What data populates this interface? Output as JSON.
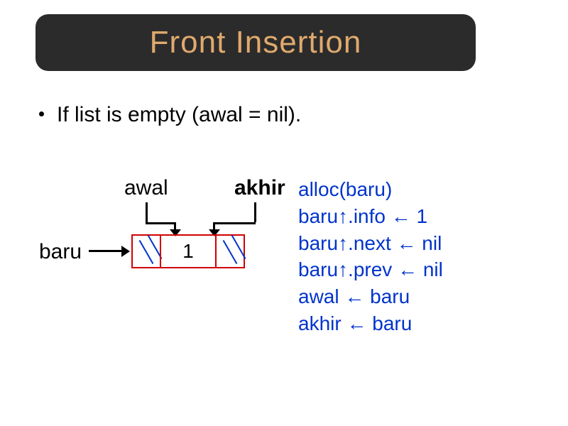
{
  "title": "Front Insertion",
  "bullet": "If list is empty (awal = nil).",
  "labels": {
    "awal": "awal",
    "akhir": "akhir",
    "baru": "baru"
  },
  "node": {
    "info": "1"
  },
  "code": {
    "l1": "alloc(baru)",
    "l2": "baru↑.info  ← 1",
    "l3": "baru↑.next  ← nil",
    "l4": "baru↑.prev  ← nil",
    "l5": "awal ← baru",
    "l6": "akhir ← baru"
  }
}
